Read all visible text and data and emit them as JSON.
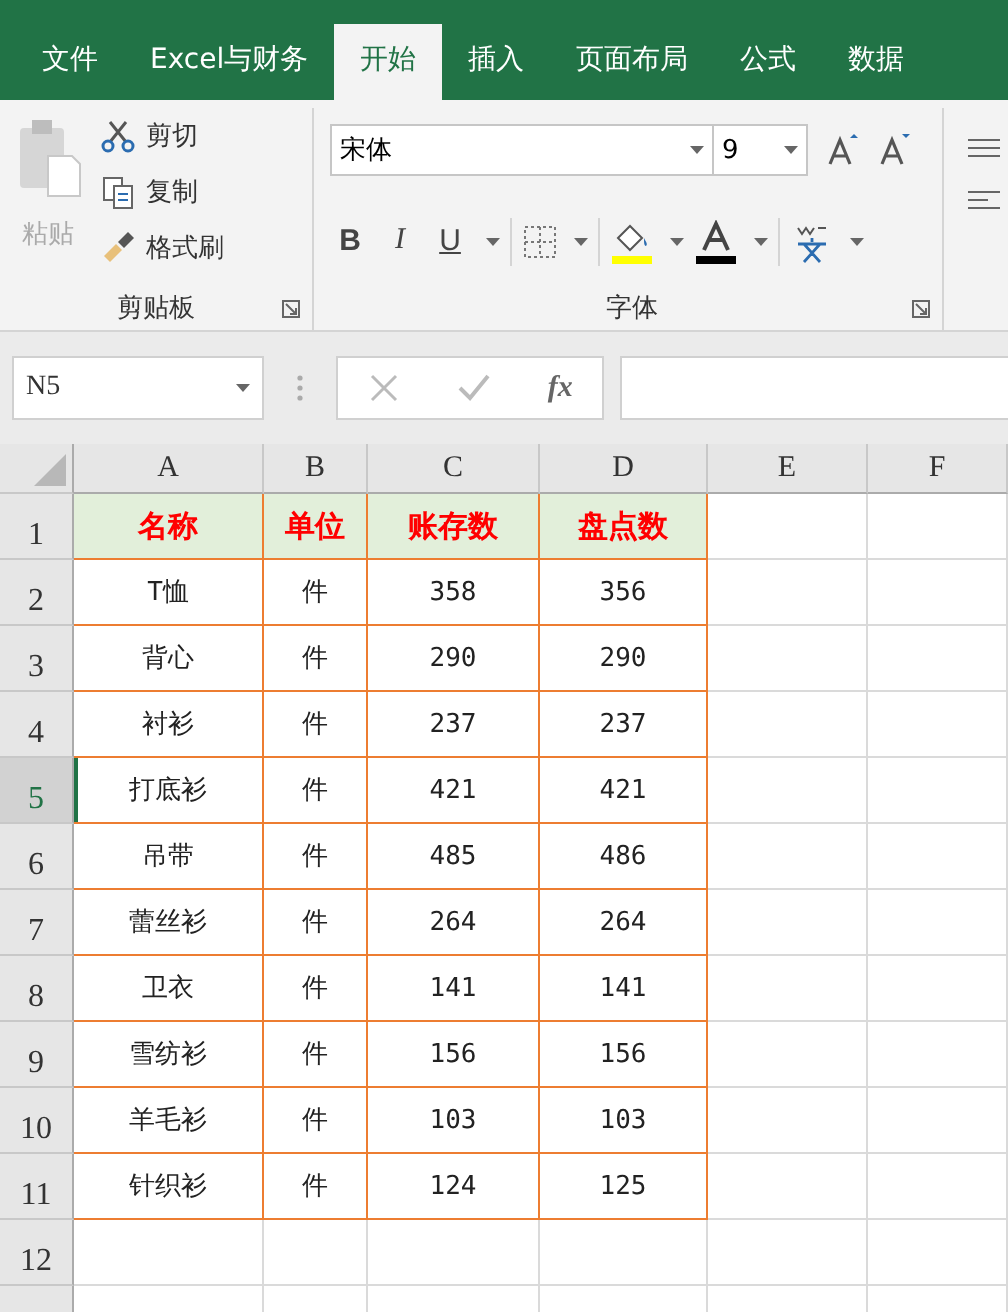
{
  "tabs": [
    {
      "label": "文件",
      "selected": false
    },
    {
      "label": "Excel与财务",
      "selected": false
    },
    {
      "label": "开始",
      "selected": true
    },
    {
      "label": "插入",
      "selected": false
    },
    {
      "label": "页面布局",
      "selected": false
    },
    {
      "label": "公式",
      "selected": false
    },
    {
      "label": "数据",
      "selected": false
    }
  ],
  "clipboard": {
    "paste": {
      "label": "粘贴",
      "disabled": true
    },
    "cut": "剪切",
    "copy": "复制",
    "format_painter": "格式刷",
    "group_label": "剪贴板"
  },
  "font": {
    "name": "宋体",
    "size": "9",
    "group_label": "字体",
    "bold": "B",
    "italic": "I",
    "underline": "U"
  },
  "formula_bar": {
    "name_box": "N5",
    "fx": "fx"
  },
  "columns": [
    "A",
    "B",
    "C",
    "D",
    "E",
    "F"
  ],
  "rows": [
    {
      "label": "1",
      "selected": false,
      "kind": "header",
      "cells": [
        "名称",
        "单位",
        "账存数",
        "盘点数"
      ]
    },
    {
      "label": "2",
      "selected": false,
      "kind": "data",
      "cells": [
        "T恤",
        "件",
        "358",
        "356"
      ]
    },
    {
      "label": "3",
      "selected": false,
      "kind": "data",
      "cells": [
        "背心",
        "件",
        "290",
        "290"
      ]
    },
    {
      "label": "4",
      "selected": false,
      "kind": "data",
      "cells": [
        "衬衫",
        "件",
        "237",
        "237"
      ]
    },
    {
      "label": "5",
      "selected": true,
      "kind": "data",
      "cells": [
        "打底衫",
        "件",
        "421",
        "421"
      ]
    },
    {
      "label": "6",
      "selected": false,
      "kind": "data",
      "cells": [
        "吊带",
        "件",
        "485",
        "486"
      ]
    },
    {
      "label": "7",
      "selected": false,
      "kind": "data",
      "cells": [
        "蕾丝衫",
        "件",
        "264",
        "264"
      ]
    },
    {
      "label": "8",
      "selected": false,
      "kind": "data",
      "cells": [
        "卫衣",
        "件",
        "141",
        "141"
      ]
    },
    {
      "label": "9",
      "selected": false,
      "kind": "data",
      "cells": [
        "雪纺衫",
        "件",
        "156",
        "156"
      ]
    },
    {
      "label": "10",
      "selected": false,
      "kind": "data",
      "cells": [
        "羊毛衫",
        "件",
        "103",
        "103"
      ]
    },
    {
      "label": "11",
      "selected": false,
      "kind": "data",
      "cells": [
        "针织衫",
        "件",
        "124",
        "125"
      ]
    },
    {
      "label": "12",
      "selected": false,
      "kind": "empty",
      "cells": []
    }
  ]
}
